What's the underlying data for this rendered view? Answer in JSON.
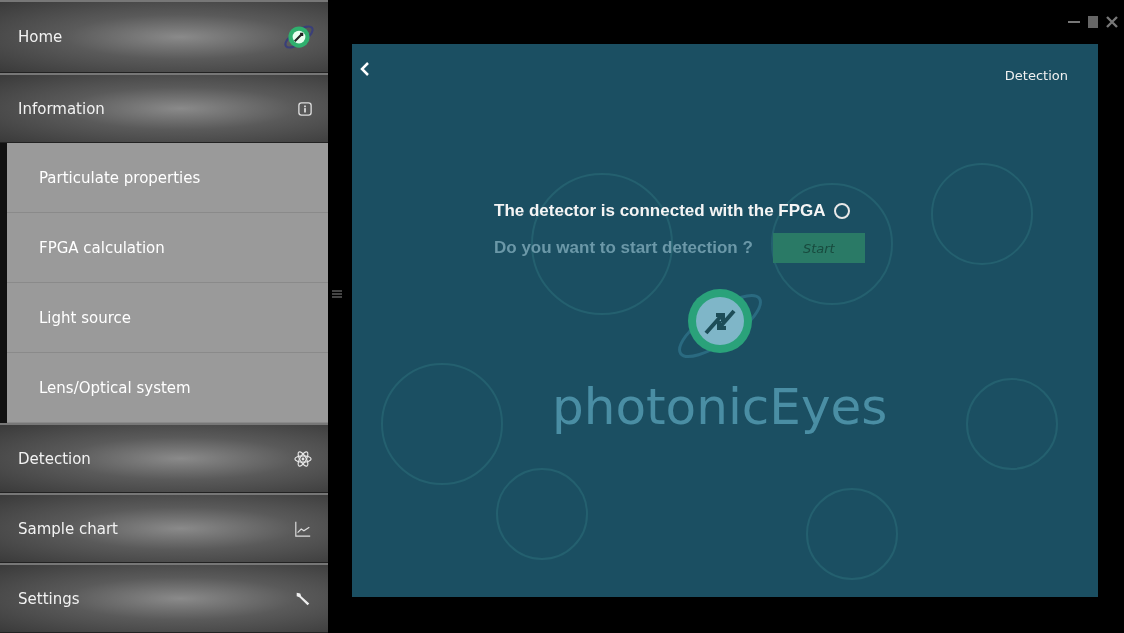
{
  "menu": [
    {
      "label": "Home"
    },
    {
      "label": "Information",
      "expanded": true,
      "children": [
        {
          "label": "Particulate properties"
        },
        {
          "label": "FPGA calculation"
        },
        {
          "label": "Light source"
        },
        {
          "label": "Lens/Optical system"
        }
      ]
    },
    {
      "label": "Detection"
    },
    {
      "label": "Sample chart"
    },
    {
      "label": "Settings"
    }
  ],
  "panel": {
    "title": "Detection",
    "status": {
      "text": "The detector is connected with the FPGA",
      "on": false
    },
    "prompt": {
      "text": "Do you want to start detection ?",
      "disabled": true
    },
    "start_button": "Start",
    "watermark": "photonicEyes"
  }
}
